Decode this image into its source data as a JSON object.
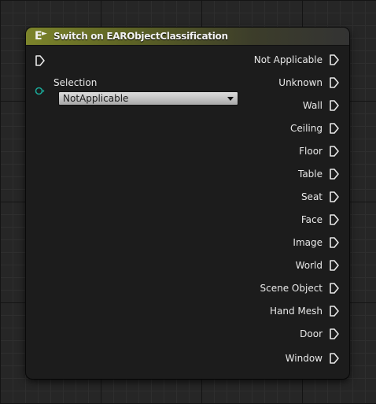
{
  "node": {
    "title": "Switch on EARObjectClassification",
    "icon": "switch-icon",
    "header_color": "#7c842b"
  },
  "input": {
    "selection_label": "Selection",
    "selection_value": "NotApplicable",
    "pin_color": "#1aa696"
  },
  "outputs": [
    {
      "label": "Not Applicable"
    },
    {
      "label": "Unknown"
    },
    {
      "label": "Wall"
    },
    {
      "label": "Ceiling"
    },
    {
      "label": "Floor"
    },
    {
      "label": "Table"
    },
    {
      "label": "Seat"
    },
    {
      "label": "Face"
    },
    {
      "label": "Image"
    },
    {
      "label": "World"
    },
    {
      "label": "Scene Object"
    },
    {
      "label": "Hand Mesh"
    },
    {
      "label": "Door"
    },
    {
      "label": "Window"
    }
  ]
}
